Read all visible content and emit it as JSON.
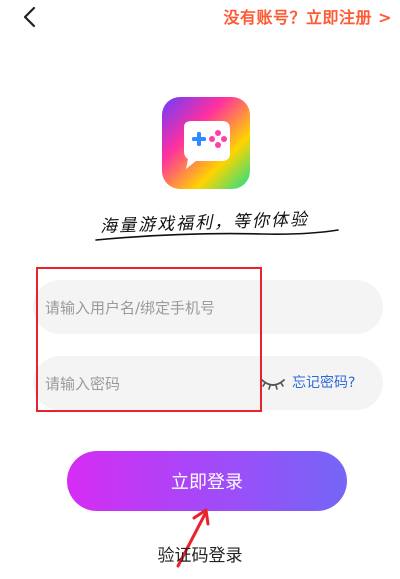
{
  "header": {
    "back_icon": "chevron-left-icon",
    "register_link": "没有账号？立即注册 >",
    "register_color": "#ff5a36"
  },
  "brand": {
    "app_icon": "gamepad-icon",
    "slogan": "海量游戏福利，等你体验"
  },
  "form": {
    "username_placeholder": "请输入用户名/绑定手机号",
    "username_value": "",
    "password_placeholder": "请输入密码",
    "password_value": "",
    "eye_icon": "eye-closed-icon",
    "forgot_password": "忘记密码?",
    "forgot_color": "#2f6bd8"
  },
  "actions": {
    "login_label": "立即登录",
    "login_gradient": [
      "#d62cf3",
      "#7466f7"
    ],
    "sms_login_label": "验证码登录"
  },
  "annotations": {
    "highlight_color": "#e8232c",
    "arrow_color": "#e8232c"
  }
}
